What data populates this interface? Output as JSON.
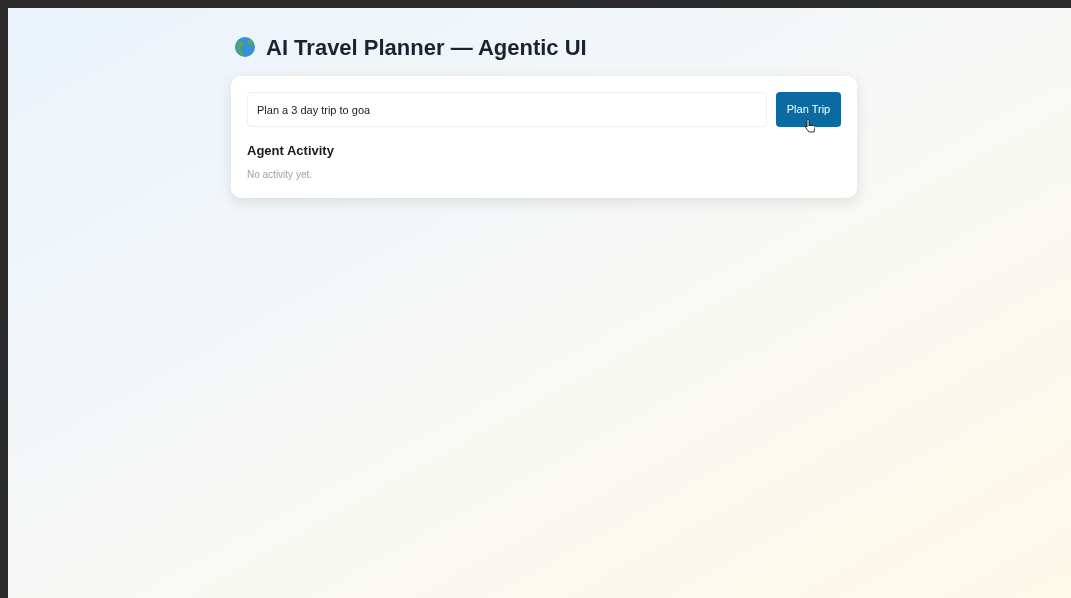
{
  "title": "AI Travel Planner — Agentic UI",
  "prompt": {
    "value": "Plan a 3 day trip to goa"
  },
  "button": "Plan Trip",
  "activity": {
    "heading": "Agent Activity",
    "empty_message": "No activity yet."
  }
}
